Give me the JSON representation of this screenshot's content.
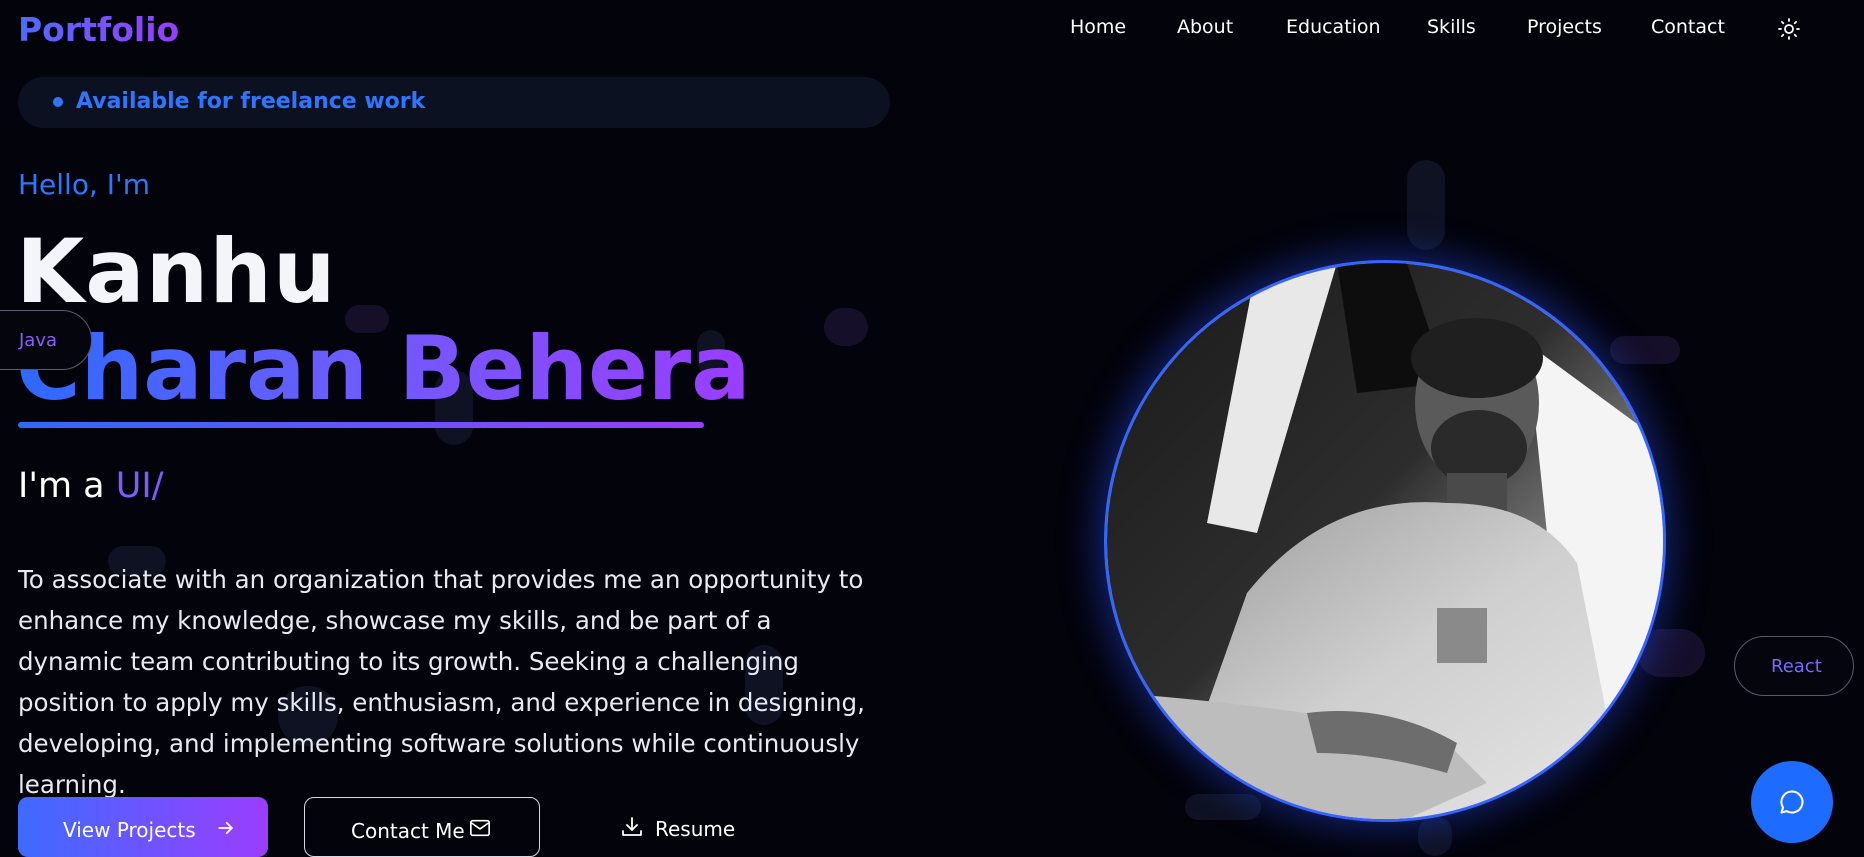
{
  "brand": "Portfolio",
  "nav": {
    "items": [
      "Home",
      "About",
      "Education",
      "Skills",
      "Projects",
      "Contact"
    ],
    "theme_icon": "sun-icon"
  },
  "hero": {
    "badge": "Available for freelance work",
    "greeting": "Hello, I'm",
    "name_first": "Kanhu",
    "name_rest": "Charan Behera",
    "role_prefix": "I'm a ",
    "role_typed": "UI/",
    "description": "To associate with an organization that provides me an opportunity to enhance my knowledge, showcase my skills, and be part of a dynamic team contributing to its growth. Seeking a challenging position to apply my skills, enthusiasm, and experience in designing, developing, and implementing software solutions while continuously learning.",
    "buttons": {
      "projects": "View Projects",
      "contact": "Contact Me",
      "resume": "Resume"
    }
  },
  "skill_pills": {
    "left": "Java",
    "right": "React"
  },
  "colors": {
    "background": "#03030b",
    "accent_blue": "#2f76ff",
    "accent_purple": "#9b3dff"
  },
  "icons": [
    "sun-icon",
    "arrow-right-icon",
    "mail-icon",
    "download-icon",
    "chat-icon",
    "badge-dot-icon"
  ]
}
